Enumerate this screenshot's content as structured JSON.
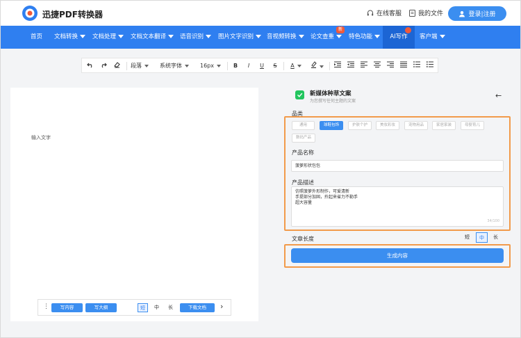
{
  "header": {
    "brand": "迅捷PDF转换器",
    "service_link": "在线客服",
    "my_files_link": "我的文件",
    "login_label": "登录|注册"
  },
  "nav": {
    "items": [
      "首页",
      "文档转换",
      "文档处理",
      "文档文本翻译",
      "语音识别",
      "图片文字识别",
      "音视频转换",
      "论文查重",
      "特色功能",
      "AI写作",
      "客户端"
    ],
    "badge_new": "新",
    "active_item": "AI写作"
  },
  "toolbar": {
    "paragraph": "段落",
    "font_family": "系统字体",
    "font_size": "16px",
    "bold": "B",
    "italic": "I",
    "underline": "U",
    "strike": "S",
    "font_color": "A"
  },
  "editor": {
    "placeholder": "输入文字",
    "write_content": "写内容",
    "write_outline": "写大纲",
    "len_short": "短",
    "len_medium": "中",
    "len_long": "长",
    "download": "下载文档"
  },
  "panel": {
    "title": "新媒体种草文案",
    "subtitle": "为您撰写任何主题的文案",
    "category_label": "品类",
    "categories": [
      "通用",
      "球鞋包饰",
      "护肤个护",
      "美妆彩妆",
      "宠物用品",
      "家居家装",
      "母婴育儿",
      "数码产品"
    ],
    "active_category": "球鞋包饰",
    "product_name_label": "产品名称",
    "product_name_value": "菠萝形状包包",
    "product_desc_label": "产品描述",
    "product_desc_lines": [
      "仿照菠萝外形制作，可爱清新",
      "手提部分加固，拎起来省力不勒手",
      "超大容量"
    ],
    "char_count": "34/100",
    "length_label": "文章长度",
    "len_short": "短",
    "len_medium": "中",
    "len_long": "长",
    "generate": "生成内容"
  },
  "colors": {
    "primary": "#3b8ef0",
    "nav_bg": "#2f7ff0",
    "highlight": "#f29a4a",
    "badge": "#f05a3a"
  }
}
